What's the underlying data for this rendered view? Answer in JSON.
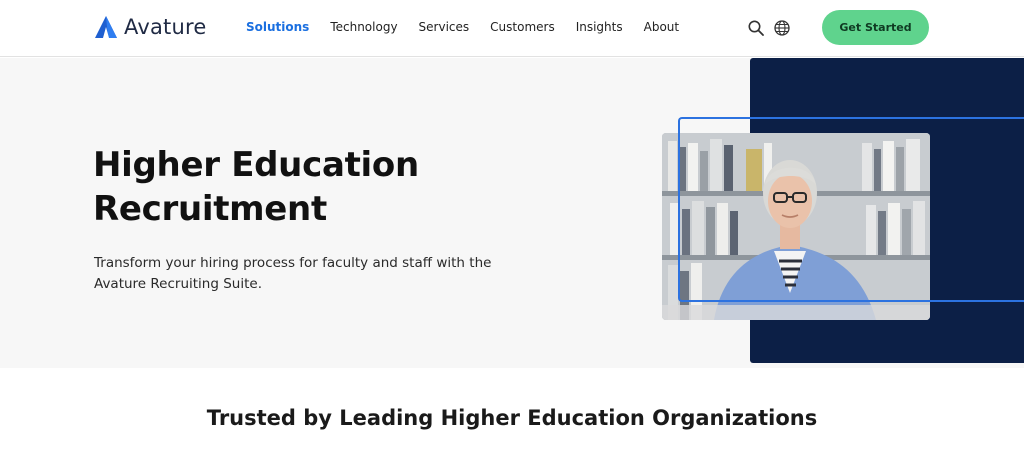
{
  "brand": {
    "name": "Avature",
    "logo_icon": "avature-logo-icon",
    "accent": "#1a6fe0"
  },
  "nav": {
    "items": [
      {
        "label": "Solutions",
        "active": true
      },
      {
        "label": "Technology",
        "active": false
      },
      {
        "label": "Services",
        "active": false
      },
      {
        "label": "Customers",
        "active": false
      },
      {
        "label": "Insights",
        "active": false
      },
      {
        "label": "About",
        "active": false
      }
    ]
  },
  "header": {
    "icons": [
      "search-icon",
      "globe-icon"
    ],
    "cta_label": "Get Started",
    "cta_color": "#5fd38d"
  },
  "hero": {
    "title": "Higher Education Recruitment",
    "subtitle": "Transform your hiring process for faculty and staff with the Avature Recruiting Suite.",
    "panel_color": "#0c1f46",
    "frame_color": "#2c72e0"
  },
  "trusted": {
    "heading": "Trusted by Leading Higher Education Organizations"
  }
}
